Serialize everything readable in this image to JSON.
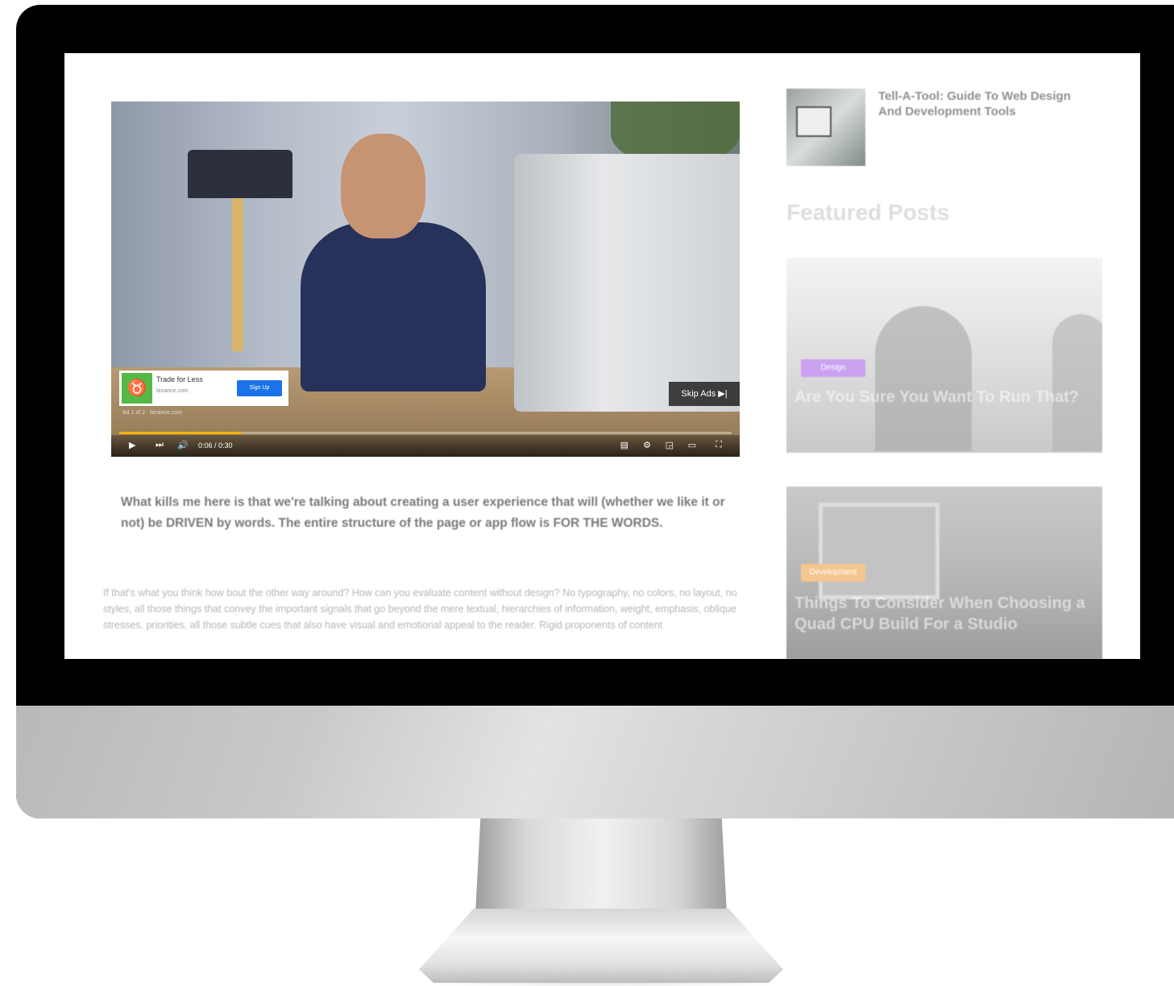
{
  "ad": {
    "logo_glyph": "♉",
    "title": "Trade for Less",
    "subtitle": "binance.com",
    "button": "Sign Up",
    "line": "Ad 1 of 2 · binance.com"
  },
  "video": {
    "skip_label": "Skip Ads ▶|",
    "time": "0:06 / 0:30",
    "progress_fraction": 0.2
  },
  "article": {
    "quote": "What kills me here is that we're talking about creating a user experience that will (whether we like it or not) be DRIVEN by words. The entire structure of the page or app flow is FOR THE WORDS.",
    "body": "If that's what you think how bout the other way around? How can you evaluate content without design? No typography, no colors, no layout, no styles, all those things that convey the important signals that go beyond the mere textual, hierarchies of information, weight, emphasis, oblique stresses, priorities, all those subtle cues that also have visual and emotional appeal to the reader. Rigid proponents of content"
  },
  "sidebar": {
    "top_post_title": "Tell-A-Tool: Guide To Web Design And Development Tools",
    "featured_heading": "Featured Posts",
    "cards": [
      {
        "tag": "Design",
        "title": "Are You Sure You Want To Run That?"
      },
      {
        "tag": "Development",
        "title": "Things To Consider When Choosing a Quad CPU Build For a Studio"
      }
    ]
  }
}
